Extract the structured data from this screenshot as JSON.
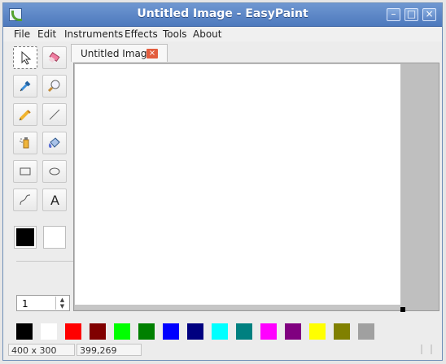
{
  "window": {
    "title": "Untitled Image - EasyPaint",
    "buttons": {
      "minimize": "–",
      "maximize": "□",
      "close": "×"
    }
  },
  "menu": [
    "File",
    "Edit",
    "Instruments",
    "Effects",
    "Tools",
    "About"
  ],
  "tabs": [
    {
      "label": "Untitled Image",
      "close": "×"
    }
  ],
  "tools": [
    {
      "name": "cursor-icon"
    },
    {
      "name": "eraser-icon"
    },
    {
      "name": "color-picker-icon"
    },
    {
      "name": "magnifier-icon"
    },
    {
      "name": "pencil-icon"
    },
    {
      "name": "line-icon"
    },
    {
      "name": "spray-icon"
    },
    {
      "name": "fill-bucket-icon"
    },
    {
      "name": "rectangle-icon"
    },
    {
      "name": "ellipse-icon"
    },
    {
      "name": "curve-icon"
    },
    {
      "name": "text-icon",
      "label": "A"
    }
  ],
  "colors": {
    "primary": "#000000",
    "secondary": "#ffffff"
  },
  "pen_size": "1",
  "palette": [
    "#000000",
    "#ffffff",
    "#ff0000",
    "#800000",
    "#00ff00",
    "#008000",
    "#0000ff",
    "#000080",
    "#00ffff",
    "#008080",
    "#ff00ff",
    "#800080",
    "#ffff00",
    "#808000",
    "#a0a0a0"
  ],
  "status": {
    "size": "400 x 300",
    "position": "399,269"
  }
}
